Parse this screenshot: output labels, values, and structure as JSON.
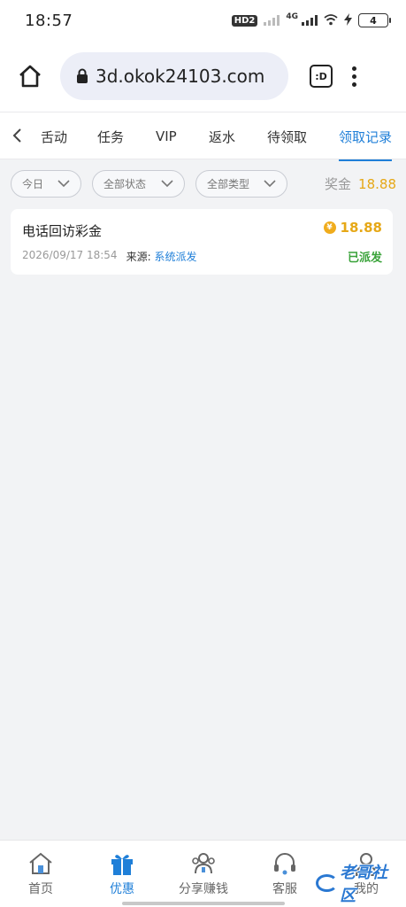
{
  "status_bar": {
    "time": "18:57",
    "hd_label": "HD2",
    "network_label": "4G",
    "battery": "4"
  },
  "browser": {
    "url": "3d.okok24103.com",
    "tabs_label": ":D"
  },
  "tabs": [
    {
      "label": "活动",
      "shown": "舌动"
    },
    {
      "label": "任务"
    },
    {
      "label": "VIP"
    },
    {
      "label": "返水"
    },
    {
      "label": "待领取"
    },
    {
      "label": "领取记录",
      "active": true
    }
  ],
  "filters": {
    "date": "今日",
    "status": "全部状态",
    "type": "全部类型",
    "bonus_label": "奖金",
    "bonus_value": "18.88"
  },
  "records": [
    {
      "title": "电话回访彩金",
      "amount": "18.88",
      "coin_symbol": "¥",
      "datetime": "2026/09/17 18:54",
      "source_label": "来源:",
      "source_value": "系统派发",
      "status": "已派发"
    }
  ],
  "bottom_nav": [
    {
      "label": "首页",
      "icon": "home-icon"
    },
    {
      "label": "优惠",
      "icon": "gift-icon",
      "active": true
    },
    {
      "label": "分享赚钱",
      "icon": "share-people-icon"
    },
    {
      "label": "客服",
      "icon": "headset-icon"
    },
    {
      "label": "我的",
      "icon": "profile-icon"
    }
  ],
  "watermark": "老哥社区",
  "colors": {
    "accent": "#1f7fd8",
    "gold": "#e6a817",
    "success": "#3aa33a"
  }
}
